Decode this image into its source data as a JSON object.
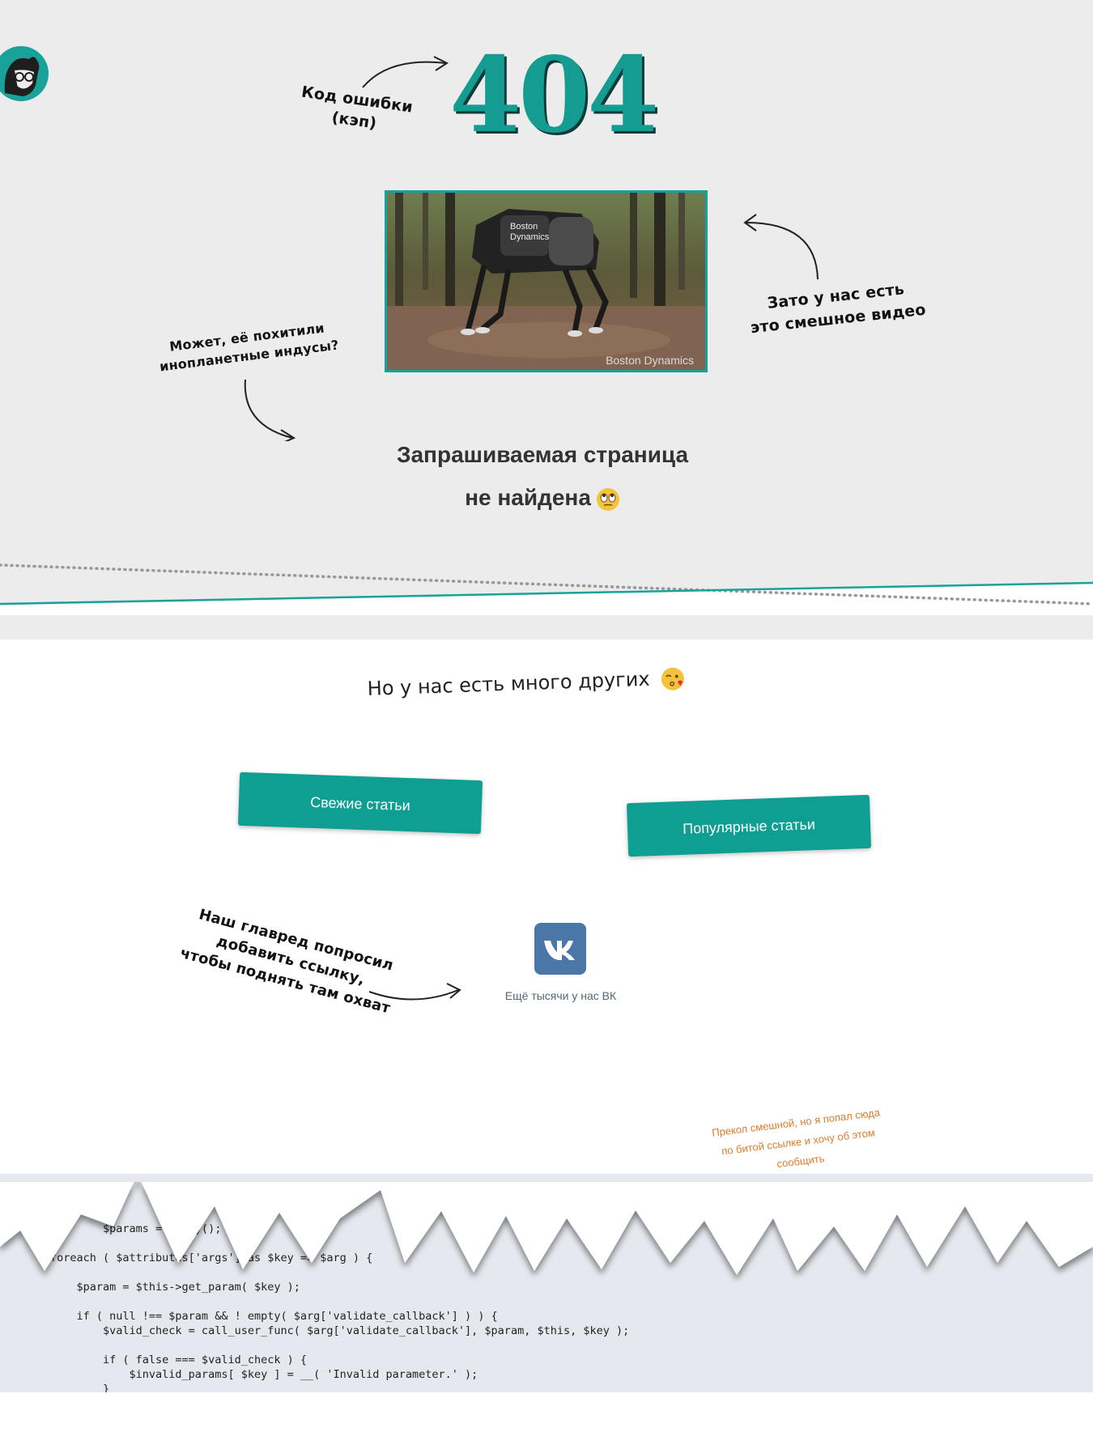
{
  "header": {
    "code": "404",
    "note_code": [
      "Код ошибки",
      "(кэп)"
    ],
    "note_video": [
      "Зато у нас есть",
      "это смешное видео"
    ],
    "note_aliens": [
      "Может, её похитили",
      "инопланетные индусы?"
    ],
    "video_watermark": "Boston Dynamics",
    "video_badge": [
      "Boston",
      "Dynamics"
    ],
    "notfound_line1": "Запрашиваемая страница",
    "notfound_line2": "не найдена"
  },
  "main": {
    "many_title": "Но у нас есть много других",
    "btn_fresh": "Свежие статьи",
    "btn_popular": "Популярные статьи",
    "note_editor": [
      "Наш главред попросил",
      "добавить ссылку,",
      "чтобы поднять там охват"
    ],
    "vk_caption": "Ещё тысячи у нас ВК",
    "report_link": "Прекол смешной, но я попал сюда по битой ссылке и хочу об этом сообщить"
  },
  "colors": {
    "accent": "#0f9f92",
    "background_top": "#ececec",
    "background_bottom": "#ffffff",
    "report_link": "#e07a2a",
    "vk": "#4a76a8"
  },
  "icons": [
    "avatar-logo-icon",
    "video-thumbnail",
    "eye-roll-emoji-icon",
    "kiss-emoji-icon",
    "vk-icon",
    "arrow-icon"
  ],
  "code_snippet": [
    "        $params = array();",
    "foreach ( $attributes['args'] as $key => $arg ) {",
    "    $param = $this->get_param( $key );",
    "    if ( null !== $param && ! empty( $arg['validate_callback'] ) ) {",
    "        $valid_check = call_user_func( $arg['validate_callback'], $param, $this, $key );",
    "        if ( false === $valid_check ) {",
    "            $invalid_params[ $key ] = __( 'Invalid parameter.' );",
    "        }"
  ]
}
